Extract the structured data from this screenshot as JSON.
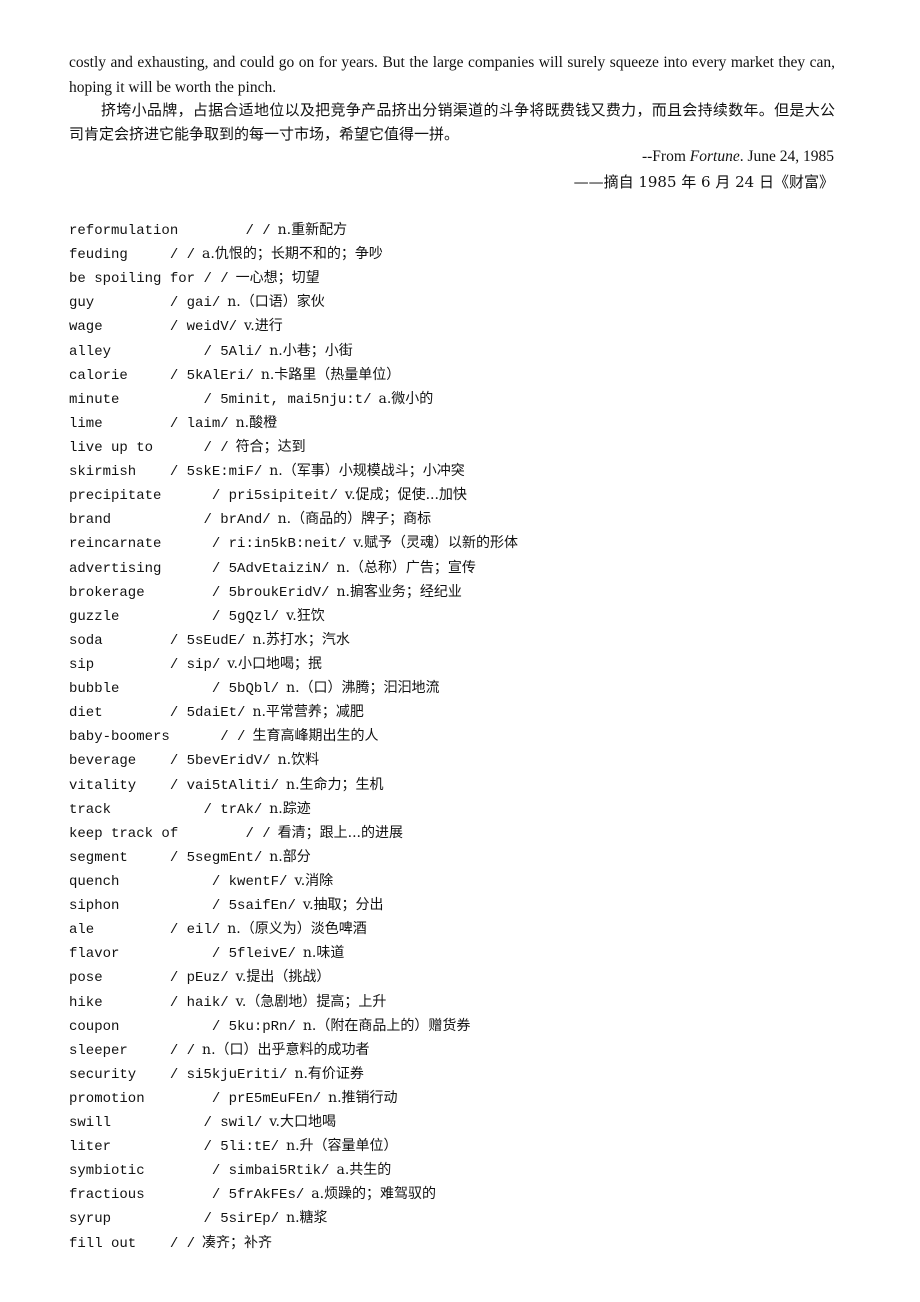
{
  "article": {
    "english_paragraph_end": "costly and exhausting, and could go on for years. But the large companies will surely squeeze into every market they can, hoping it will be worth the pinch.",
    "chinese_paragraph": "挤垮小品牌，占据合适地位以及把竞争产品挤出分销渠道的斗争将既费钱又费力，而且会持续数年。但是大公司肯定会挤进它能争取到的每一寸市场，希望它值得一拼。",
    "source_prefix": "--From ",
    "source_publication": "Fortune",
    "source_date": ". June 24, 1985",
    "source_chinese": "——摘自 1985 年 6 月 24 日《财富》"
  },
  "vocabulary": [
    {
      "word": "reformulation",
      "pad": "        ",
      "phonetic": "/ /",
      "definition": "n.重新配方"
    },
    {
      "word": "feuding",
      "pad": "     ",
      "phonetic": "/ /",
      "definition": "a.仇恨的；长期不和的；争吵"
    },
    {
      "word": "be spoiling for",
      "pad": " ",
      "phonetic": "/ /",
      "definition": "一心想；切望"
    },
    {
      "word": "guy",
      "pad": "         ",
      "phonetic": "/ gai/",
      "definition": "n.（口语）家伙"
    },
    {
      "word": "wage",
      "pad": "        ",
      "phonetic": "/ weidV/",
      "definition": "v.进行"
    },
    {
      "word": "alley",
      "pad": "           ",
      "phonetic": "/ 5Ali/",
      "definition": "n.小巷；小街"
    },
    {
      "word": "calorie",
      "pad": "     ",
      "phonetic": "/ 5kAlEri/",
      "definition": "n.卡路里（热量单位）"
    },
    {
      "word": "minute",
      "pad": "          ",
      "phonetic": "/ 5minit, mai5nju:t/",
      "definition": "a.微小的"
    },
    {
      "word": "lime",
      "pad": "        ",
      "phonetic": "/ laim/",
      "definition": "n.酸橙"
    },
    {
      "word": "live up to",
      "pad": "      ",
      "phonetic": "/ /",
      "definition": "符合；达到"
    },
    {
      "word": "skirmish",
      "pad": "    ",
      "phonetic": "/ 5skE:miF/",
      "definition": "n.（军事）小规模战斗；小冲突"
    },
    {
      "word": "precipitate",
      "pad": "      ",
      "phonetic": "/ pri5sipiteit/",
      "definition": "v.促成；促使...加快"
    },
    {
      "word": "brand",
      "pad": "           ",
      "phonetic": "/ brAnd/",
      "definition": "n.（商品的）牌子；商标"
    },
    {
      "word": "reincarnate",
      "pad": "      ",
      "phonetic": "/ ri:in5kB:neit/",
      "definition": "v.赋予（灵魂）以新的形体"
    },
    {
      "word": "advertising",
      "pad": "      ",
      "phonetic": "/ 5AdvEtaiziN/",
      "definition": "n.（总称）广告；宣传"
    },
    {
      "word": "brokerage",
      "pad": "        ",
      "phonetic": "/ 5broukEridV/",
      "definition": "n.掮客业务；经纪业"
    },
    {
      "word": "guzzle",
      "pad": "           ",
      "phonetic": "/ 5gQzl/",
      "definition": "v.狂饮"
    },
    {
      "word": "soda",
      "pad": "        ",
      "phonetic": "/ 5sEudE/",
      "definition": "n.苏打水；汽水"
    },
    {
      "word": "sip",
      "pad": "         ",
      "phonetic": "/ sip/",
      "definition": "v.小口地喝；抿"
    },
    {
      "word": "bubble",
      "pad": "           ",
      "phonetic": "/ 5bQbl/",
      "definition": "n.（口）沸腾；汩汩地流"
    },
    {
      "word": "diet",
      "pad": "        ",
      "phonetic": "/ 5daiEt/",
      "definition": "n.平常营养；减肥"
    },
    {
      "word": "baby-boomers",
      "pad": "      ",
      "phonetic": "/ /",
      "definition": "生育高峰期出生的人"
    },
    {
      "word": "beverage",
      "pad": "    ",
      "phonetic": "/ 5bevEridV/",
      "definition": "n.饮料"
    },
    {
      "word": "vitality",
      "pad": "    ",
      "phonetic": "/ vai5tAliti/",
      "definition": "n.生命力；生机"
    },
    {
      "word": "track",
      "pad": "           ",
      "phonetic": "/ trAk/",
      "definition": "n.踪迹"
    },
    {
      "word": "keep track of",
      "pad": "        ",
      "phonetic": "/ /",
      "definition": "看清；跟上...的进展"
    },
    {
      "word": "segment",
      "pad": "     ",
      "phonetic": "/ 5segmEnt/",
      "definition": "n.部分"
    },
    {
      "word": "quench",
      "pad": "           ",
      "phonetic": "/ kwentF/",
      "definition": "v.消除"
    },
    {
      "word": "siphon",
      "pad": "           ",
      "phonetic": "/ 5saifEn/",
      "definition": "v.抽取；分出"
    },
    {
      "word": "ale",
      "pad": "         ",
      "phonetic": "/ eil/",
      "definition": "n.（原义为）淡色啤酒"
    },
    {
      "word": "flavor",
      "pad": "           ",
      "phonetic": "/ 5fleivE/",
      "definition": "n.味道"
    },
    {
      "word": "pose",
      "pad": "        ",
      "phonetic": "/ pEuz/",
      "definition": "v.提出（挑战）"
    },
    {
      "word": "hike",
      "pad": "        ",
      "phonetic": "/ haik/",
      "definition": "v.（急剧地）提高；上升"
    },
    {
      "word": "coupon",
      "pad": "           ",
      "phonetic": "/ 5ku:pRn/",
      "definition": "n.（附在商品上的）赠货券"
    },
    {
      "word": "sleeper",
      "pad": "     ",
      "phonetic": "/ /",
      "definition": "n.（口）出乎意料的成功者"
    },
    {
      "word": "security",
      "pad": "    ",
      "phonetic": "/ si5kjuEriti/",
      "definition": "n.有价证券"
    },
    {
      "word": "promotion",
      "pad": "        ",
      "phonetic": "/ prE5mEuFEn/",
      "definition": "n.推销行动"
    },
    {
      "word": "swill",
      "pad": "           ",
      "phonetic": "/ swil/",
      "definition": "v.大口地喝"
    },
    {
      "word": "liter",
      "pad": "           ",
      "phonetic": "/ 5li:tE/",
      "definition": "n.升（容量单位）"
    },
    {
      "word": "symbiotic",
      "pad": "        ",
      "phonetic": "/ simbai5Rtik/",
      "definition": "a.共生的"
    },
    {
      "word": "fractious",
      "pad": "        ",
      "phonetic": "/ 5frAkFEs/",
      "definition": "a.烦躁的；难驾驭的"
    },
    {
      "word": "syrup",
      "pad": "           ",
      "phonetic": "/ 5sirEp/",
      "definition": "n.糖浆"
    },
    {
      "word": "fill out",
      "pad": "    ",
      "phonetic": "/ /",
      "definition": "凑齐；补齐"
    }
  ]
}
